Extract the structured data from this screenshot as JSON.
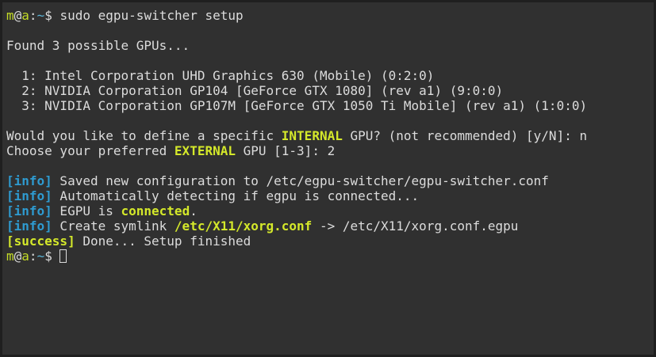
{
  "prompt": {
    "user": "m",
    "at": "@",
    "host": "a",
    "sep": ":",
    "path": "~",
    "symbol": "$"
  },
  "command": " sudo egpu-switcher setup",
  "found": "Found 3 possible GPUs...",
  "gpus": [
    "  1: Intel Corporation UHD Graphics 630 (Mobile) (0:2:0)",
    "  2: NVIDIA Corporation GP104 [GeForce GTX 1080] (rev a1) (9:0:0)",
    "  3: NVIDIA Corporation GP107M [GeForce GTX 1050 Ti Mobile] (rev a1) (1:0:0)"
  ],
  "q_internal": {
    "pre": "Would you like to define a specific ",
    "kw": "INTERNAL",
    "post": " GPU? (not recommended) [y/N]: n"
  },
  "q_external": {
    "pre": "Choose your preferred ",
    "kw": "EXTERNAL",
    "post": " GPU [1-3]: 2"
  },
  "info_tag": "[info]",
  "success_tag": "[success]",
  "log": {
    "saved": " Saved new configuration to /etc/egpu-switcher/egpu-switcher.conf",
    "detect": " Automatically detecting if egpu is connected...",
    "egpu_pre": " EGPU is ",
    "egpu_kw": "connected",
    "egpu_post": ".",
    "symlink_pre": " Create symlink ",
    "symlink_kw": "/etc/X11/xorg.conf",
    "symlink_post": " -> /etc/X11/xorg.conf.egpu",
    "done": " Done... Setup finished"
  },
  "colors": {
    "background": "#303030",
    "text": "#dcdcdc",
    "highlight": "#d4e82a",
    "info": "#2e9bd1",
    "path": "#5ab3d6"
  }
}
